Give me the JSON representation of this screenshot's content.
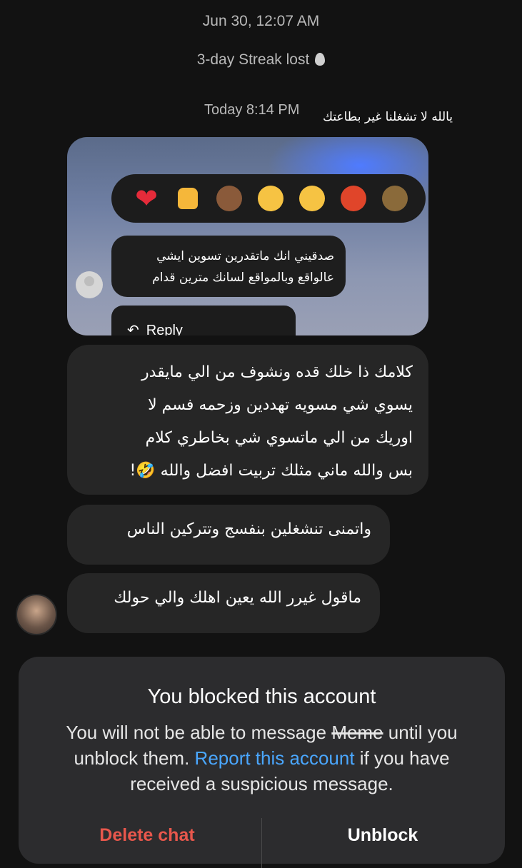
{
  "timestamps": {
    "first": "Jun 30, 12:07 AM",
    "streak_lost": "3-day Streak lost",
    "today": "Today 8:14 PM"
  },
  "overlay_caption": "يالله لا تشغلنا غير بطاعتك",
  "story_reply": {
    "reactions": [
      "heart-emoji",
      "thumbs-up-emoji",
      "see-no-evil-monkey-emoji",
      "laughing-tears-emoji",
      "crying-emoji",
      "angry-face-emoji",
      "partial-emoji"
    ],
    "quoted_text_line1": "صدقيني انك ماتقدرين تسوين ايشي",
    "quoted_text_line2": "عالواقع وبالمواقع لسانك مترين قدام",
    "reply_label": "Reply"
  },
  "messages": [
    {
      "lines": [
        "كلامك ذا خلك قده ونشوف من الي مايقدر",
        "يسوي شي مسويه تهددين وزحمه فسم لا",
        "اوريك من الي ماتسوي شي بخاطري كلام",
        "بس والله ماني مثلك تربيت افضل والله 🤣!"
      ]
    },
    {
      "text": "واتمنى تنشغلين بنفسج وتتركين الناس"
    },
    {
      "text": "ماقول غيرر الله يعين اهلك والي حولك"
    }
  ],
  "blocked_panel": {
    "title": "You blocked this account",
    "body_part1": "You will not be able to message ",
    "blocked_name": "Meme",
    "body_part2": " until you unblock them. ",
    "report_link": "Report this account",
    "body_part3": " if you have received a suspicious message.",
    "delete_label": "Delete chat",
    "unblock_label": "Unblock"
  },
  "colors": {
    "background": "#121212",
    "bubble": "#262626",
    "link": "#4aa7ff",
    "danger": "#e8574c"
  }
}
